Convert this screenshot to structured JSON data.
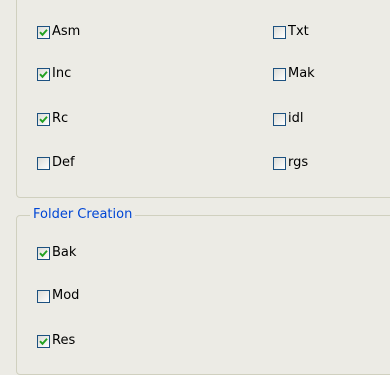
{
  "top_group": {
    "checkboxes": [
      {
        "label": "Asm",
        "checked": true
      },
      {
        "label": "Txt",
        "checked": false
      },
      {
        "label": "Inc",
        "checked": true
      },
      {
        "label": "Mak",
        "checked": false
      },
      {
        "label": "Rc",
        "checked": true
      },
      {
        "label": "idl",
        "checked": false
      },
      {
        "label": "Def",
        "checked": false
      },
      {
        "label": "rgs",
        "checked": false
      }
    ]
  },
  "folder_creation": {
    "title": "Folder Creation",
    "checkboxes": [
      {
        "label": "Bak",
        "checked": true
      },
      {
        "label": "Mod",
        "checked": false
      },
      {
        "label": "Res",
        "checked": true
      }
    ]
  },
  "colors": {
    "background": "#ecebe5",
    "group_border": "#d0d0bf",
    "group_title": "#0046d5",
    "checkbox_border": "#1c5180",
    "checkmark": "#21a121"
  }
}
